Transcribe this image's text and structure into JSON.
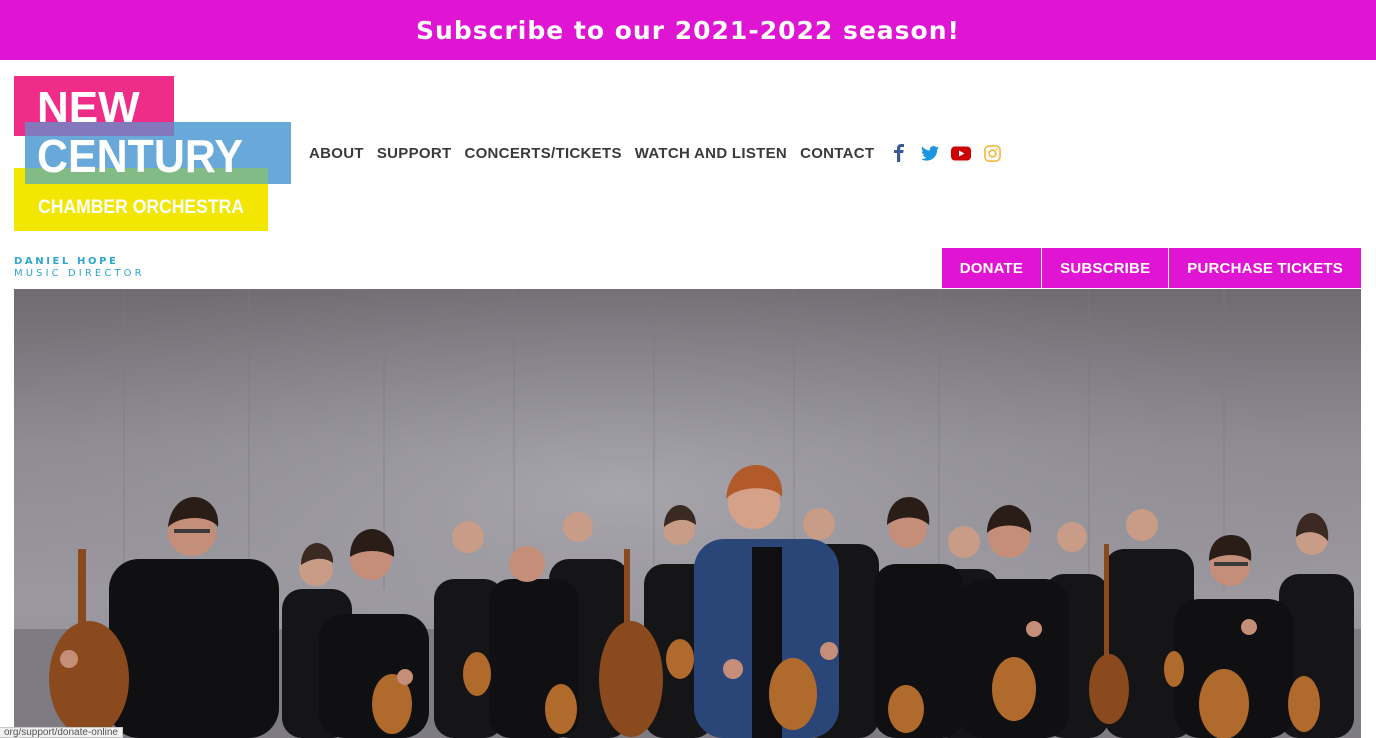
{
  "banner": {
    "text": "Subscribe to our 2021-2022 season!"
  },
  "logo": {
    "line1": "NEW",
    "line2": "CENTURY",
    "line3": "CHAMBER ORCHESTRA",
    "colors": {
      "pink": "#ef2c87",
      "blue": "#4d9ad4",
      "yellow": "#f3e600"
    }
  },
  "nav": {
    "items": [
      {
        "label": "ABOUT"
      },
      {
        "label": "SUPPORT"
      },
      {
        "label": "CONCERTS/TICKETS"
      },
      {
        "label": "WATCH AND LISTEN"
      },
      {
        "label": "CONTACT"
      }
    ],
    "social": [
      {
        "icon": "facebook-icon",
        "color": "#3b5998"
      },
      {
        "icon": "twitter-icon",
        "color": "#1da1f2"
      },
      {
        "icon": "youtube-icon",
        "color": "#cc0000"
      },
      {
        "icon": "instagram-icon",
        "color": "#f5b942"
      }
    ]
  },
  "director": {
    "name": "DANIEL HOPE",
    "title": "MUSIC DIRECTOR"
  },
  "actions": {
    "donate": "DONATE",
    "subscribe": "SUBSCRIBE",
    "purchase": "PURCHASE TICKETS"
  },
  "status": {
    "url": "org/support/donate-online"
  },
  "theme": {
    "accent": "#df15d3",
    "director_color": "#2fa6cf",
    "nav_color": "#3a3a3a"
  }
}
